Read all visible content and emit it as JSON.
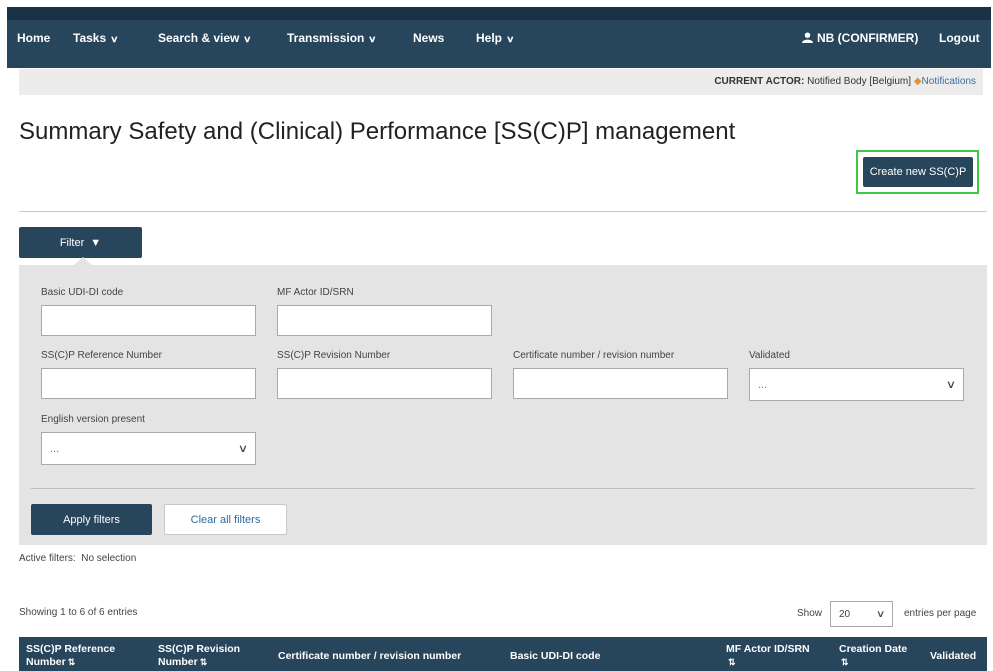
{
  "nav": {
    "home": "Home",
    "tasks": "Tasks",
    "search_view": "Search & view",
    "transmission": "Transmission",
    "news": "News",
    "help": "Help",
    "user": "NB (CONFIRMER)",
    "logout": "Logout"
  },
  "actor_bar": {
    "label": "CURRENT ACTOR:",
    "actor": "Notified Body [Belgium]",
    "notifications": "Notifications"
  },
  "page": {
    "title": "Summary Safety and (Clinical) Performance [SS(C)P] management",
    "create_button": "Create new SS(C)P"
  },
  "filter": {
    "toggle_label": "Filter",
    "fields": {
      "basic_udi_label": "Basic UDI-DI code",
      "mf_actor_label": "MF Actor ID/SRN",
      "sscp_ref_label": "SS(C)P Reference Number",
      "sscp_rev_label": "SS(C)P Revision Number",
      "certificate_label": "Certificate number / revision number",
      "validated_label": "Validated",
      "validated_value": "...",
      "english_label": "English version present",
      "english_value": "..."
    },
    "apply_label": "Apply filters",
    "clear_label": "Clear all filters"
  },
  "status": {
    "active_filters_label": "Active filters:",
    "active_filters_value": "No selection",
    "showing": "Showing 1 to 6 of 6 entries",
    "show_label": "Show",
    "page_size": "20",
    "per_page_label": "entries per page"
  },
  "table": {
    "columns": [
      {
        "line1": "SS(C)P Reference",
        "line2": "Number"
      },
      {
        "line1": "SS(C)P Revision",
        "line2": "Number"
      },
      {
        "line1": "Certificate number / revision number",
        "line2": ""
      },
      {
        "line1": "Basic UDI-DI code",
        "line2": ""
      },
      {
        "line1": "MF Actor ID/SRN",
        "line2": ""
      },
      {
        "line1": "Creation Date",
        "line2": ""
      },
      {
        "line1": "Validated",
        "line2": ""
      }
    ]
  },
  "colors": {
    "navbar": "#27455b",
    "highlight": "#3fc940",
    "panel": "#e4e4e4"
  }
}
